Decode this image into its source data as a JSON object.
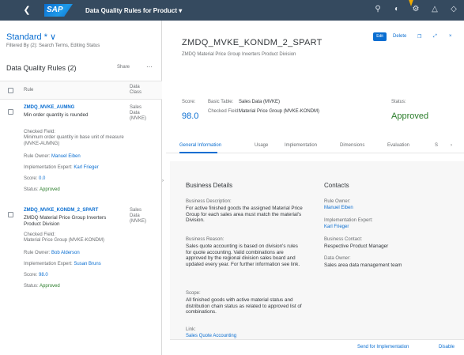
{
  "shell": {
    "back_icon": "back-arrow-icon",
    "logo": "SAP",
    "title": "Data Quality Rules for Product",
    "title_chevron": "▾",
    "icons": [
      "search-icon",
      "help-icon",
      "settings-icon",
      "notifications-icon",
      "user-icon"
    ],
    "icon_glyphs": [
      "⚲",
      "◐",
      "⚙",
      "△",
      "◇"
    ]
  },
  "left": {
    "variant": "Standard *",
    "variant_chevron": "∨",
    "filtered_by": "Filtered By (2): Search Terms, Editing Status",
    "list_title": "Data Quality Rules (2)",
    "share_label": "Share",
    "overflow_label": "⋯",
    "columns": {
      "rule": "Rule",
      "class": "Data Class"
    },
    "items": [
      {
        "name": "ZMDQ_MVKE_AUMNG",
        "desc": "Min order quantity is rounded",
        "class": "Sales Data (MVKE)",
        "checked_field_label": "Checked Field:",
        "checked_field": "Minimum order quantity in base unit of measure (MVKE-AUMNG)",
        "rule_owner_label": "Rule Owner:",
        "rule_owner": "Manuel Eiben",
        "impl_expert_label": "Implementation Expert:",
        "impl_expert": "Karl Frieger",
        "score_label": "Score:",
        "score": "0.0",
        "status_label": "Status:",
        "status": "Approved"
      },
      {
        "name": "ZMDQ_MVKE_KONDM_2_SPART",
        "desc": "ZMDQ Material Price Group Inverters Product Division",
        "class": "Sales Data (MVKE)",
        "checked_field_label": "Checked Field:",
        "checked_field": "Material Price Group (MVKE-KONDM)",
        "rule_owner_label": "Rule Owner:",
        "rule_owner": "Bob Alderson",
        "impl_expert_label": "Implementation Expert:",
        "impl_expert": "Susan Bruns",
        "score_label": "Score:",
        "score": "98.0",
        "status_label": "Status:",
        "status": "Approved"
      }
    ]
  },
  "object": {
    "title": "ZMDQ_MVKE_KONDM_2_SPART",
    "subtitle": "ZMDQ Material Price Group Inverters Product Division",
    "edit_label": "Edit",
    "delete_label": "Delete",
    "action_icons": [
      "copy-icon",
      "fullscreen-icon",
      "close-icon"
    ],
    "action_glyphs": [
      "❐",
      "⤢",
      "×"
    ],
    "score_label": "Score:",
    "score": "98.0",
    "basic_table_label": "Basic Table:",
    "basic_table": "Sales Data (MVKE)",
    "checked_field_label": "Checked Field:",
    "checked_field": "Material Price Group (MVKE-KONDM)",
    "status_label": "Status:",
    "status": "Approved",
    "tabs": [
      "General Information",
      "Usage",
      "Implementation",
      "Dimensions",
      "Evaluation",
      "S"
    ],
    "tab_more": "›",
    "business": {
      "title": "Business Details",
      "desc_label": "Business Description:",
      "desc": "For active finished goods the assigned Material Price Group for each sales area must match the material's Division.",
      "reason_label": "Business Reason:",
      "reason": "Sales quote accounting is based on division's rules for quote accounting. Valid combinations are approved by the regional division sales board and updated every year. For further information see link.",
      "scope_label": "Scope:",
      "scope": "All finished goods with active material status and distribution chain status as related to approved list of combinations.",
      "link_label": "Link:",
      "link": "Sales Quote Accounting"
    },
    "contacts": {
      "title": "Contacts",
      "rule_owner_label": "Rule Owner:",
      "rule_owner": "Manuel Eiben",
      "impl_expert_label": "Implementation Expert:",
      "impl_expert": "Karl Frieger",
      "biz_contact_label": "Business Contact:",
      "biz_contact": "Respective Product Manager",
      "data_owner_label": "Data Owner:",
      "data_owner": "Sales area data management team"
    },
    "footer": {
      "send_label": "Send for Implementation",
      "disable_label": "Disable"
    }
  }
}
